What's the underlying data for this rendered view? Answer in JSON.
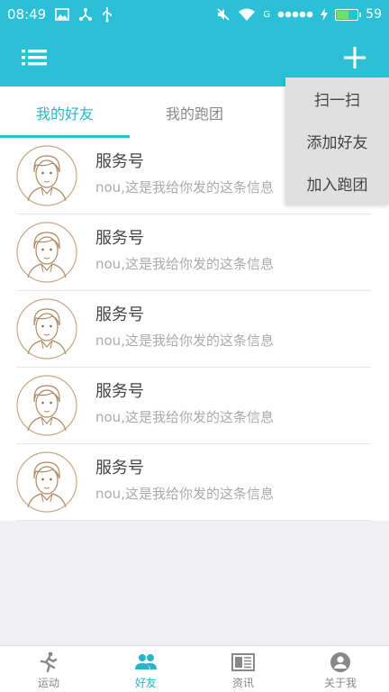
{
  "status_bar": {
    "time": "08:49",
    "network_label": "G",
    "battery_level": "59",
    "battery_fraction": 0.59,
    "icons": [
      "image-icon",
      "share-icon",
      "usb-icon",
      "mute-icon",
      "wifi-icon",
      "signal-dots-icon",
      "charging-icon",
      "battery-icon"
    ]
  },
  "header": {
    "menu_icon": "list-menu-icon",
    "add_icon": "plus-icon"
  },
  "tabs": [
    {
      "label": "我的好友",
      "active": true
    },
    {
      "label": "我的跑团",
      "active": false
    }
  ],
  "friends": [
    {
      "name": "服务号",
      "message": "nou,这是我给你发的这条信息"
    },
    {
      "name": "服务号",
      "message": "nou,这是我给你发的这条信息"
    },
    {
      "name": "服务号",
      "message": "nou,这是我给你发的这条信息"
    },
    {
      "name": "服务号",
      "message": "nou,这是我给你发的这条信息"
    },
    {
      "name": "服务号",
      "message": "nou,这是我给你发的这条信息"
    }
  ],
  "dropdown": [
    {
      "label": "扫一扫"
    },
    {
      "label": "添加好友"
    },
    {
      "label": "加入跑团"
    }
  ],
  "bottom_nav": [
    {
      "label": "运动",
      "icon": "running-icon",
      "active": false
    },
    {
      "label": "好友",
      "icon": "friends-icon",
      "active": true
    },
    {
      "label": "资讯",
      "icon": "news-icon",
      "active": false
    },
    {
      "label": "关于我",
      "icon": "profile-icon",
      "active": false
    }
  ],
  "colors": {
    "accent": "#2bc0d6",
    "active_text": "#2bb4c8",
    "battery_fill": "#6be36b"
  }
}
